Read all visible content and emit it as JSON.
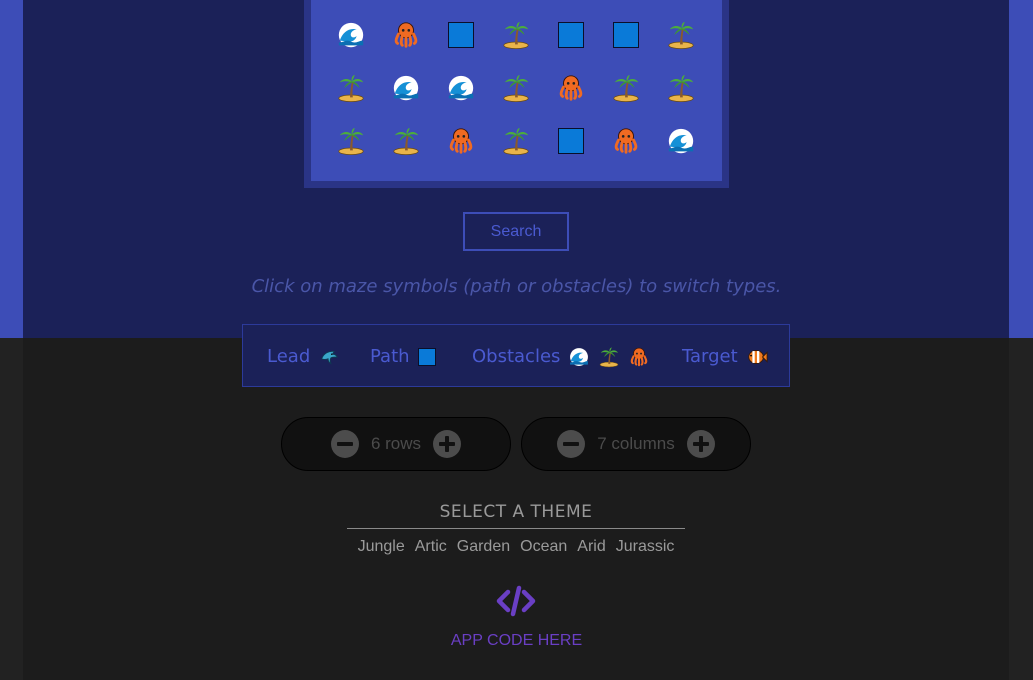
{
  "maze": {
    "rows": [
      [
        "wave",
        "octopus",
        "path",
        "palm",
        "path",
        "path",
        "palm"
      ],
      [
        "palm",
        "wave",
        "wave",
        "palm",
        "octopus",
        "palm",
        "palm"
      ],
      [
        "palm",
        "palm",
        "octopus",
        "palm",
        "path",
        "octopus",
        "wave"
      ]
    ]
  },
  "search": {
    "label": "Search"
  },
  "hint": "Click on maze symbols (path or obstacles) to switch types.",
  "legend": {
    "lead": "Lead",
    "path": "Path",
    "obstacles": "Obstacles",
    "target": "Target"
  },
  "rows_stepper": {
    "label": "6 rows"
  },
  "cols_stepper": {
    "label": "7 columns"
  },
  "theme": {
    "title": "SELECT A THEME",
    "options": [
      "Jungle",
      "Artic",
      "Garden",
      "Ocean",
      "Arid",
      "Jurassic"
    ]
  },
  "footer": {
    "app_code": "APP CODE HERE"
  },
  "colors": {
    "accent": "#3d4db7",
    "path_blue": "#0a7ad8",
    "code_purple": "#6a3fc4"
  }
}
